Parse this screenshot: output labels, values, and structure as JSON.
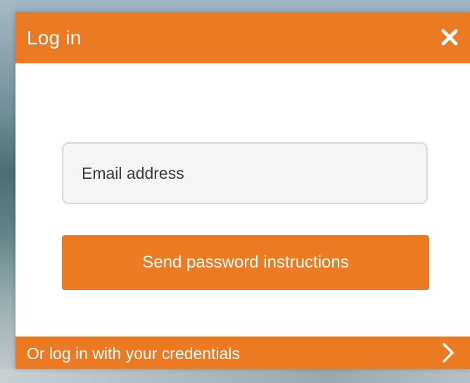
{
  "modal": {
    "title": "Log in",
    "close_icon": "close-icon",
    "email": {
      "value": "",
      "placeholder": "Email address"
    },
    "send_button_label": "Send password instructions",
    "footer": {
      "label": "Or log in with your credentials",
      "icon": "chevron-right-icon"
    }
  },
  "colors": {
    "accent": "#ec7a22",
    "field_background": "#f5f5f5",
    "field_border": "#d9d9d9",
    "text_on_accent": "#ffffff"
  }
}
